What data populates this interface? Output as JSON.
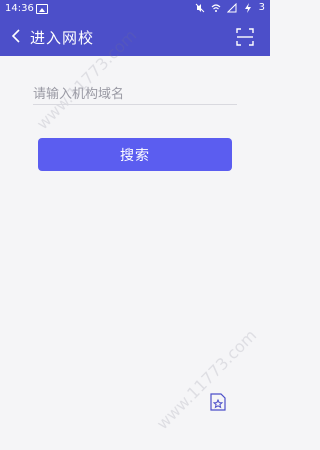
{
  "status_bar": {
    "time": "14:36",
    "battery": "3"
  },
  "header": {
    "title": "进入网校"
  },
  "search": {
    "placeholder": "请输入机构域名",
    "button_label": "搜索"
  },
  "watermark": {
    "text": "www.11773.com"
  },
  "colors": {
    "primary": "#4c4fc9",
    "button": "#5b5df0",
    "background": "#f5f5f7"
  }
}
